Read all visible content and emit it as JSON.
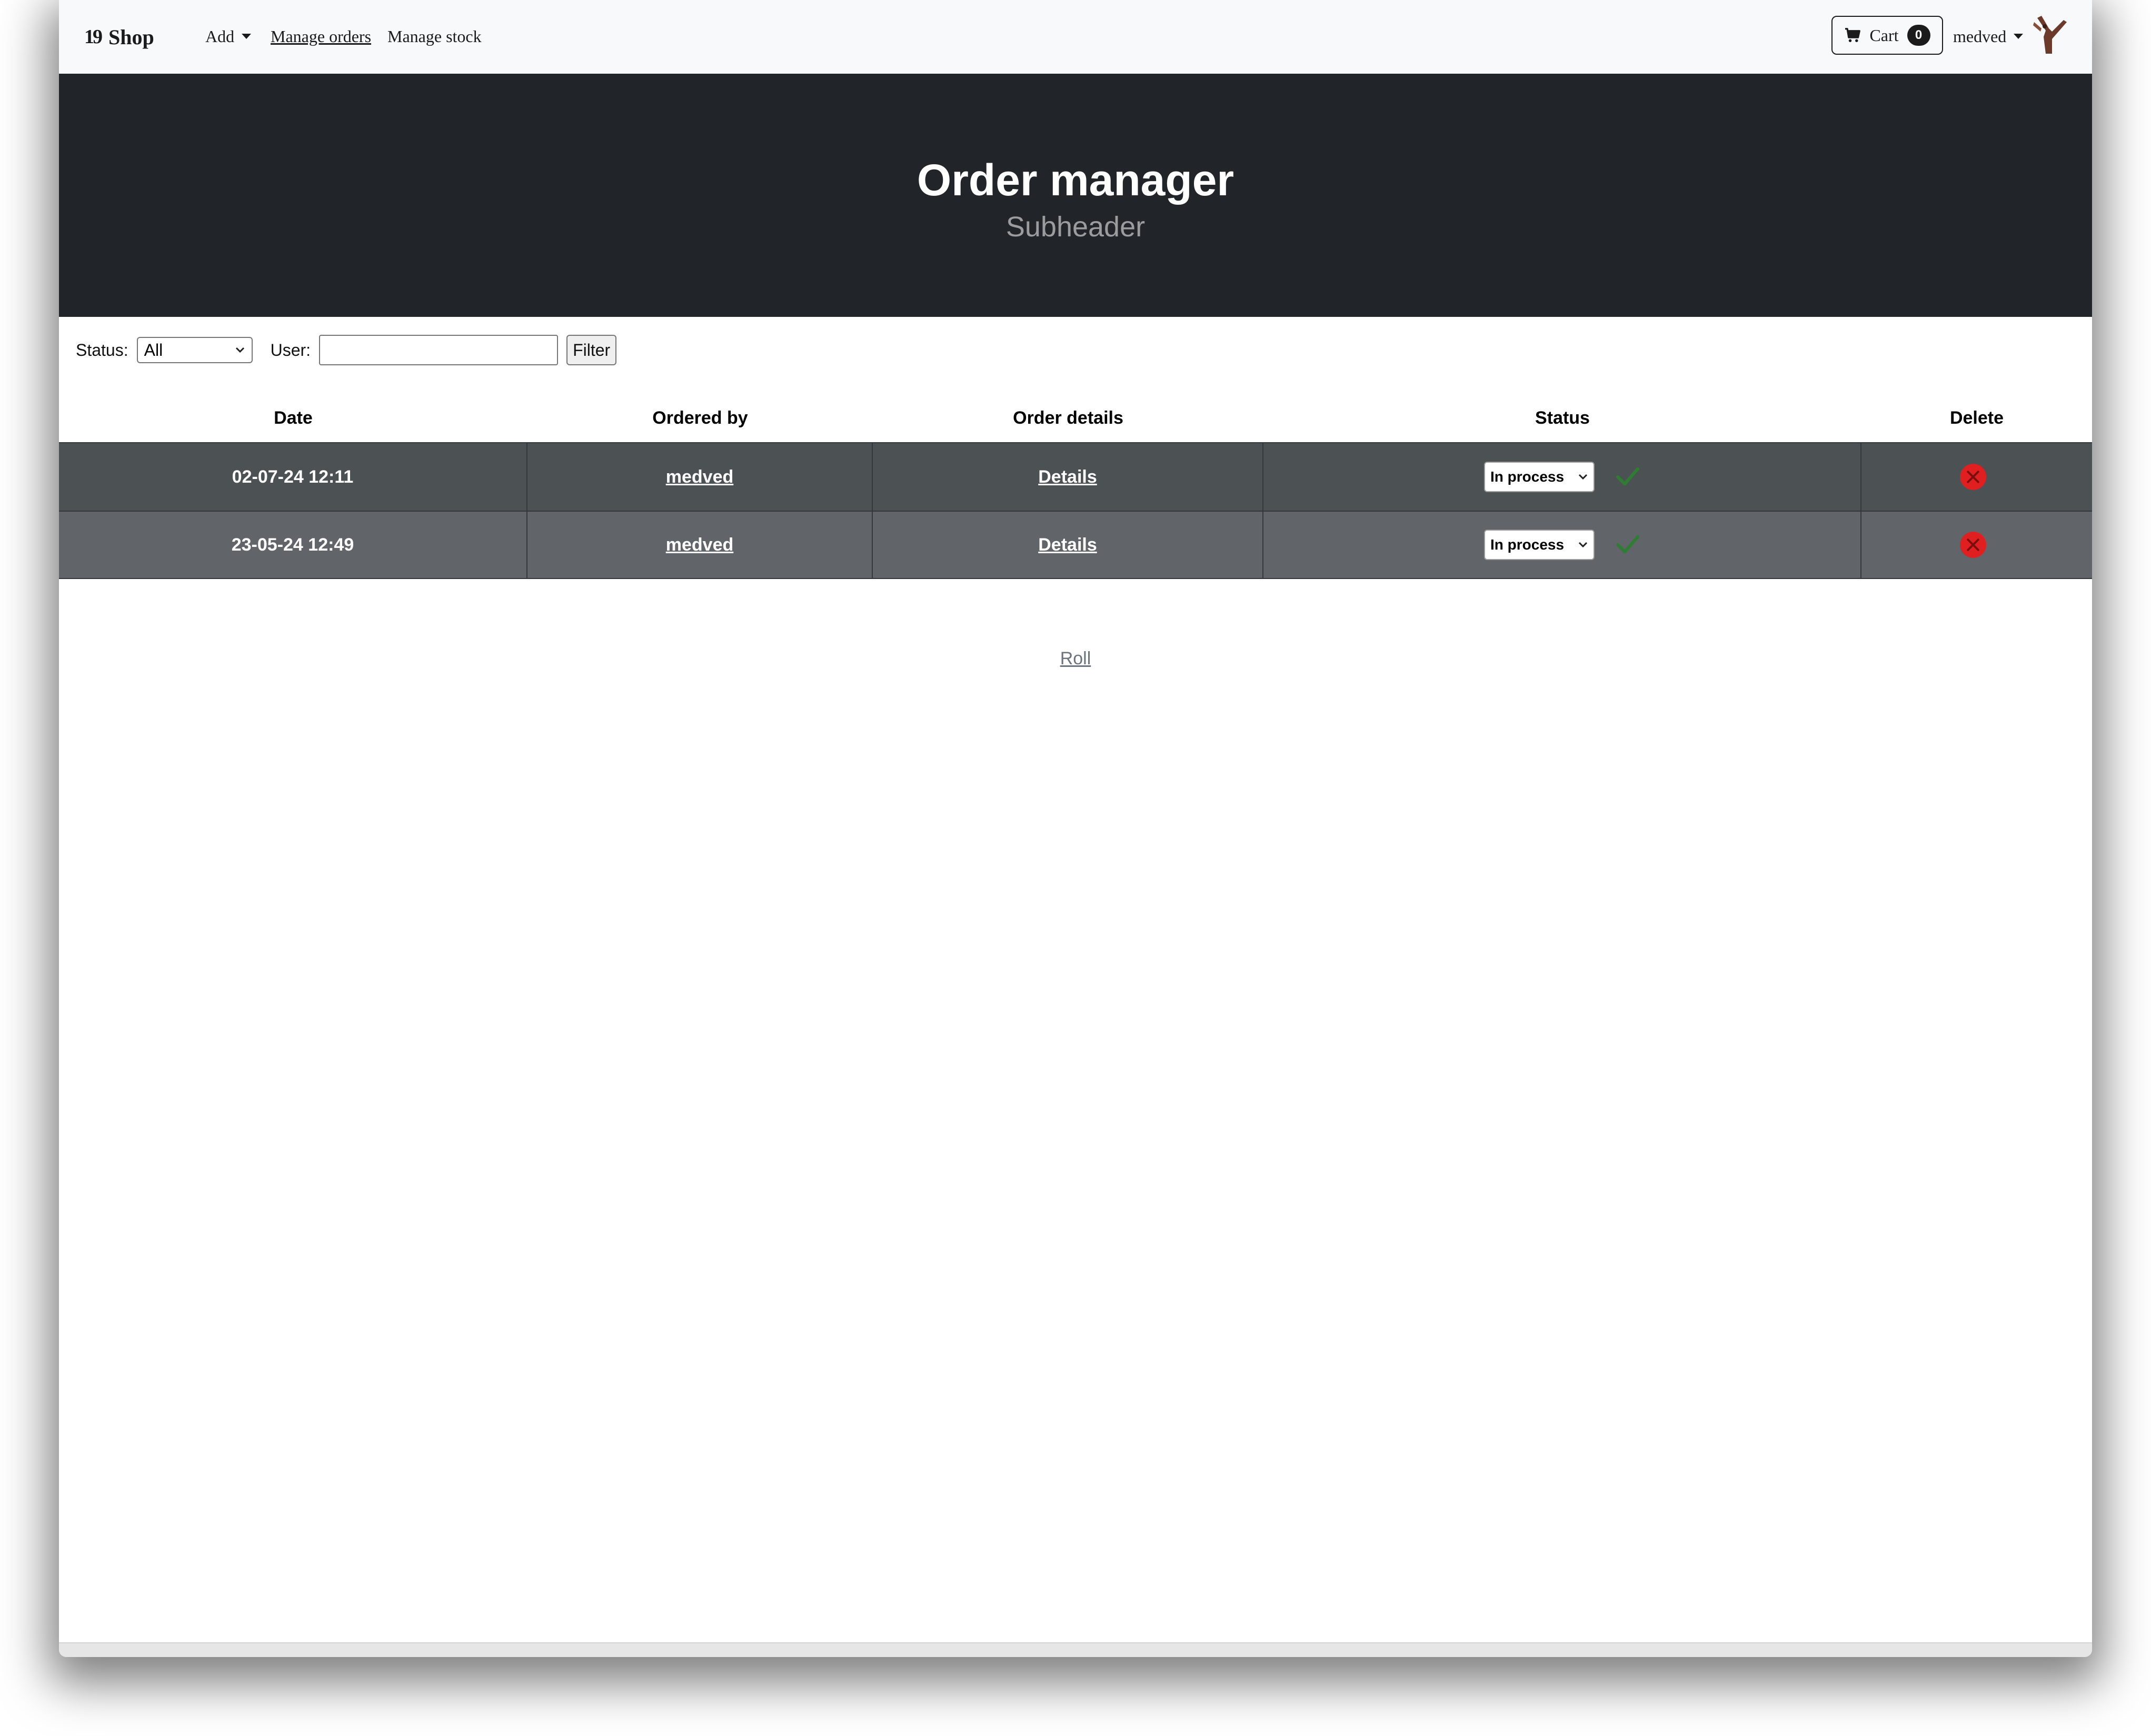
{
  "navbar": {
    "brand_logo": "19",
    "brand_text": "Shop",
    "add_label": "Add",
    "manage_orders_label": "Manage orders",
    "manage_stock_label": "Manage stock",
    "cart_label": "Cart",
    "cart_count": "0",
    "user_label": "medved"
  },
  "header": {
    "title": "Order manager",
    "subtitle": "Subheader"
  },
  "filter": {
    "status_label": "Status:",
    "status_value": "All",
    "user_label": "User:",
    "user_value": "",
    "filter_button": "Filter"
  },
  "table": {
    "columns": [
      "Date",
      "Ordered by",
      "Order details",
      "Status",
      "Delete"
    ],
    "rows": [
      {
        "date": "02-07-24 12:11",
        "ordered_by": "medved",
        "details": "Details",
        "status": "In process"
      },
      {
        "date": "23-05-24 12:49",
        "ordered_by": "medved",
        "details": "Details",
        "status": "In process"
      }
    ]
  },
  "footer": {
    "roll_link": "Roll"
  },
  "colors": {
    "navbar_bg": "#f8f9fa",
    "header_bg": "#212529",
    "row1_bg": "#4c5154",
    "row2_bg": "#616569",
    "check_color": "#2e7d32",
    "delete_color": "#e02020"
  },
  "icons": [
    "cart-icon",
    "chevron-down-icon",
    "check-icon",
    "delete-icon",
    "avatar"
  ]
}
